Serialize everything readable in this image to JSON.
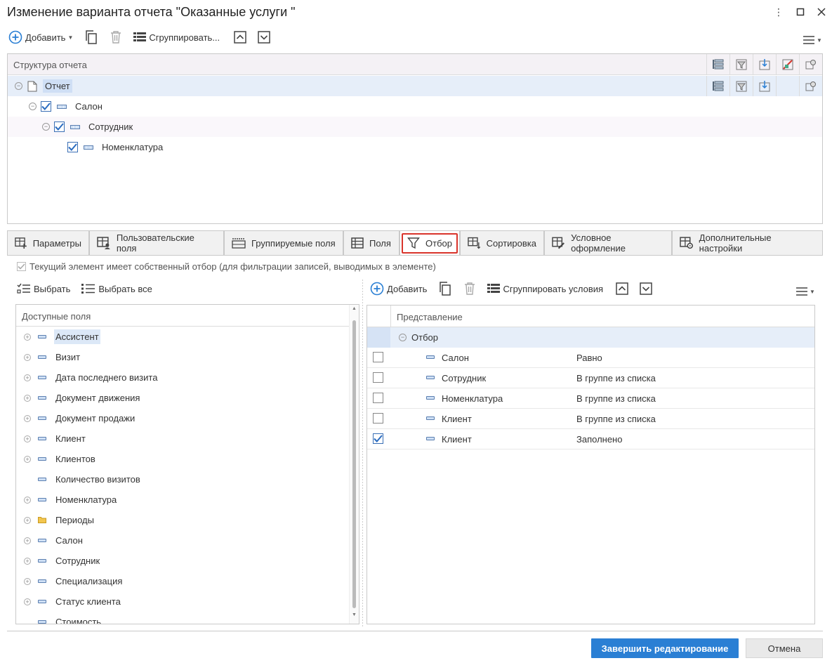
{
  "window": {
    "title": "Изменение варианта отчета \"Оказанные услуги \"",
    "more_icon": "more-vertical-icon",
    "maximize_icon": "maximize-icon",
    "close_icon": "close-icon"
  },
  "top_toolbar": {
    "add_label": "Добавить",
    "group_label": "Сгруппировать..."
  },
  "structure": {
    "header": "Структура отчета",
    "nodes": [
      {
        "label": "Отчет",
        "checked": null,
        "selected": true
      },
      {
        "label": "Салон",
        "checked": true
      },
      {
        "label": "Сотрудник",
        "checked": true
      },
      {
        "label": "Номенклатура",
        "checked": true
      }
    ]
  },
  "tabs": [
    {
      "label": "Параметры",
      "icon": "parameters-icon"
    },
    {
      "label": "Пользовательские поля",
      "icon": "user-fields-icon"
    },
    {
      "label": "Группируемые поля",
      "icon": "grouped-fields-icon"
    },
    {
      "label": "Поля",
      "icon": "fields-icon"
    },
    {
      "label": "Отбор",
      "icon": "filter-icon",
      "active": true
    },
    {
      "label": "Сортировка",
      "icon": "sort-icon"
    },
    {
      "label": "Условное оформление",
      "icon": "conditional-format-icon"
    },
    {
      "label": "Дополнительные настройки",
      "icon": "additional-settings-icon"
    }
  ],
  "own_filter_option": "Текущий элемент имеет собственный отбор (для фильтрации записей, выводимых в элементе)",
  "left_toolbar": {
    "select_label": "Выбрать",
    "select_all_label": "Выбрать все"
  },
  "available_fields": {
    "header": "Доступные поля",
    "items": [
      {
        "label": "Ассистент",
        "expandable": true,
        "type": "field",
        "selected": true
      },
      {
        "label": "Визит",
        "expandable": true,
        "type": "field"
      },
      {
        "label": "Дата последнего визита",
        "expandable": true,
        "type": "field"
      },
      {
        "label": "Документ движения",
        "expandable": true,
        "type": "field"
      },
      {
        "label": "Документ продажи",
        "expandable": true,
        "type": "field"
      },
      {
        "label": "Клиент",
        "expandable": true,
        "type": "field"
      },
      {
        "label": "Клиентов",
        "expandable": true,
        "type": "field"
      },
      {
        "label": "Количество визитов",
        "expandable": false,
        "type": "field"
      },
      {
        "label": "Номенклатура",
        "expandable": true,
        "type": "field"
      },
      {
        "label": "Периоды",
        "expandable": true,
        "type": "folder"
      },
      {
        "label": "Салон",
        "expandable": true,
        "type": "field"
      },
      {
        "label": "Сотрудник",
        "expandable": true,
        "type": "field"
      },
      {
        "label": "Специализация",
        "expandable": true,
        "type": "field"
      },
      {
        "label": "Статус клиента",
        "expandable": true,
        "type": "field"
      },
      {
        "label": "Стоимость",
        "expandable": false,
        "type": "field"
      }
    ]
  },
  "right_toolbar": {
    "add_label": "Добавить",
    "group_conditions_label": "Сгруппировать условия"
  },
  "filters": {
    "header": "Представление",
    "root_label": "Отбор",
    "rows": [
      {
        "field": "Салон",
        "condition": "Равно",
        "checked": false
      },
      {
        "field": "Сотрудник",
        "condition": "В группе из списка",
        "checked": false
      },
      {
        "field": "Номенклатура",
        "condition": "В группе из списка",
        "checked": false
      },
      {
        "field": "Клиент",
        "condition": "В группе из списка",
        "checked": false
      },
      {
        "field": "Клиент",
        "condition": "Заполнено",
        "checked": true
      }
    ]
  },
  "footer": {
    "finish_label": "Завершить редактирование",
    "cancel_label": "Отмена"
  },
  "colors": {
    "accent": "#2a7fd4",
    "highlight": "#d9342b",
    "selection": "#dce8f7"
  }
}
